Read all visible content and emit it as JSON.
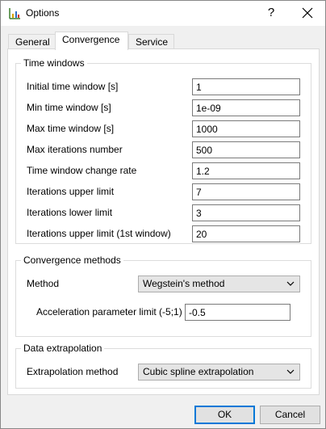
{
  "window": {
    "title": "Options"
  },
  "tabs": [
    {
      "label": "General",
      "active": false
    },
    {
      "label": "Convergence",
      "active": true
    },
    {
      "label": "Service",
      "active": false
    }
  ],
  "time_windows": {
    "title": "Time windows",
    "fields": [
      {
        "label": "Initial time window [s]",
        "value": "1"
      },
      {
        "label": "Min time window [s]",
        "value": "1e-09"
      },
      {
        "label": "Max time window [s]",
        "value": "1000"
      },
      {
        "label": "Max iterations number",
        "value": "500"
      },
      {
        "label": "Time window change rate",
        "value": "1.2"
      },
      {
        "label": "Iterations upper limit",
        "value": "7"
      },
      {
        "label": "Iterations lower limit",
        "value": "3"
      },
      {
        "label": "Iterations upper limit (1st window)",
        "value": "20"
      }
    ]
  },
  "convergence_methods": {
    "title": "Convergence methods",
    "method_label": "Method",
    "method_value": "Wegstein's method",
    "accel_label": "Acceleration parameter limit (-5;1)",
    "accel_value": "-0.5"
  },
  "data_extrapolation": {
    "title": "Data extrapolation",
    "method_label": "Extrapolation method",
    "method_value": "Cubic spline extrapolation"
  },
  "buttons": {
    "ok": "OK",
    "cancel": "Cancel"
  },
  "glyphs": {
    "help": "?"
  },
  "colors": {
    "accent": "#0078d7"
  }
}
